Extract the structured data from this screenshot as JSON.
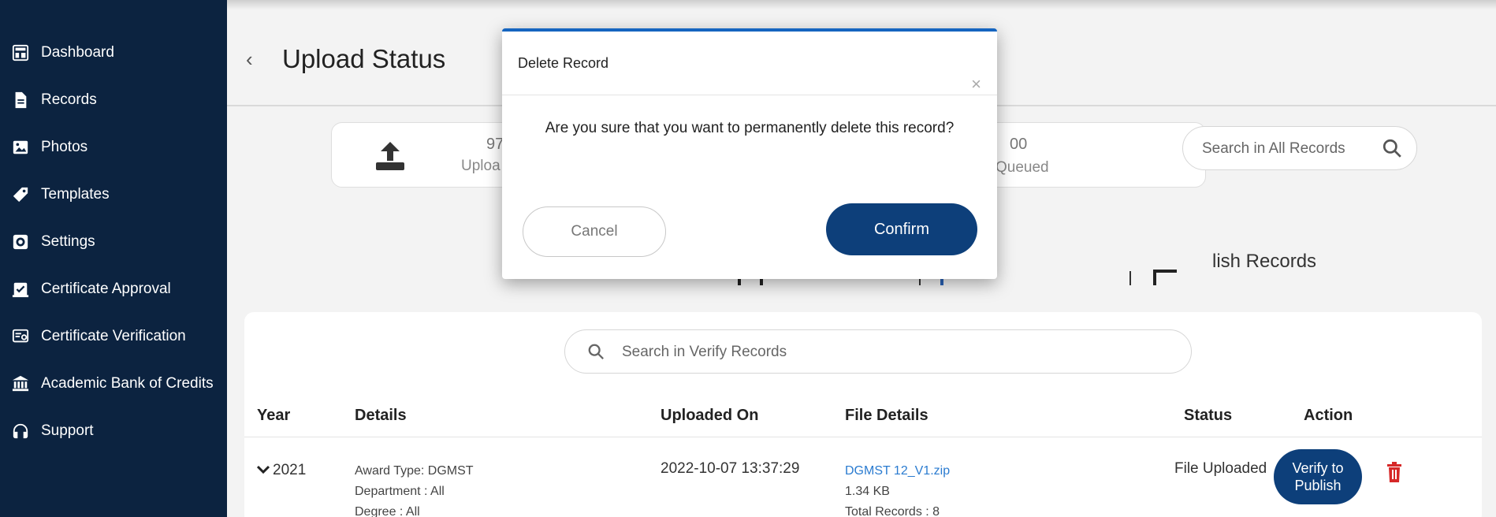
{
  "sidebar": {
    "items": [
      {
        "label": "Dashboard",
        "icon": "dashboard-icon"
      },
      {
        "label": "Records",
        "icon": "document-icon"
      },
      {
        "label": "Photos",
        "icon": "photo-icon"
      },
      {
        "label": "Templates",
        "icon": "tag-icon"
      },
      {
        "label": "Settings",
        "icon": "gear-icon"
      },
      {
        "label": "Certificate Approval",
        "icon": "approval-icon"
      },
      {
        "label": "Certificate Verification",
        "icon": "verification-icon"
      },
      {
        "label": "Academic Bank of Credits",
        "icon": "bank-icon"
      },
      {
        "label": "Support",
        "icon": "headset-icon"
      }
    ]
  },
  "header": {
    "title": "Upload Status",
    "back_icon": "‹"
  },
  "stats": {
    "uploaded_count": "97",
    "uploaded_label": "Uploa",
    "queued_count": "00",
    "queued_label": "Queued"
  },
  "search_all": {
    "placeholder": "Search in All Records"
  },
  "tabs": {
    "visible_label": "lish Records"
  },
  "search_verify": {
    "placeholder": "Search in Verify Records"
  },
  "table": {
    "headers": [
      "Year",
      "Details",
      "Uploaded On",
      "File Details",
      "Status",
      "Action"
    ],
    "rows": [
      {
        "year": "2021",
        "award_type": "Award Type: DGMST",
        "department": "Department : All",
        "degree": "Degree : All",
        "uploaded_on": "2022-10-07 13:37:29",
        "file_name": "DGMST 12_V1.zip",
        "file_size": "1.34 KB",
        "total_records": "Total Records : 8",
        "status": "File Uploaded",
        "action_label": "Verify to Publish"
      }
    ]
  },
  "modal": {
    "title": "Delete Record",
    "close": "×",
    "message": "Are you sure that you want to permanently delete this record?",
    "cancel_label": "Cancel",
    "confirm_label": "Confirm",
    "accent_color": "#1565c0"
  },
  "colors": {
    "sidebar_bg": "#0c2340",
    "primary_button": "#0d3f7a",
    "delete_icon": "#d62828"
  }
}
